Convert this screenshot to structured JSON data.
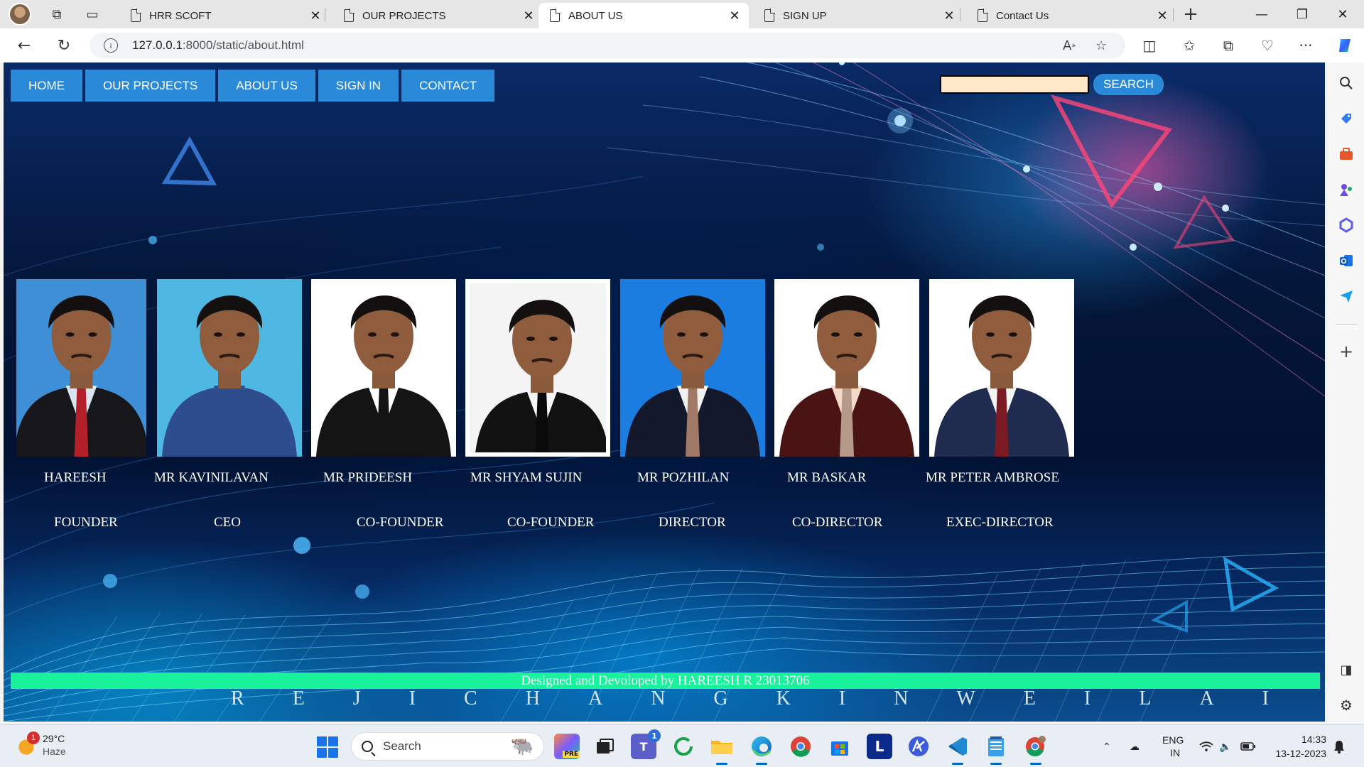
{
  "browser": {
    "tabs": [
      {
        "label": "HRR SCOFT",
        "active": false
      },
      {
        "label": "OUR PROJECTS",
        "active": false
      },
      {
        "label": "ABOUT US",
        "active": true
      },
      {
        "label": "SIGN UP",
        "active": false
      },
      {
        "label": "Contact Us",
        "active": false
      }
    ],
    "url_host": "127.0.0.1",
    "url_path": ":8000/static/about.html"
  },
  "page": {
    "nav": [
      "HOME",
      "OUR PROJECTS",
      "ABOUT US",
      "SIGN IN",
      "CONTACT"
    ],
    "search_button": "SEARCH",
    "members": [
      {
        "name": "HAREESH",
        "role": "FOUNDER",
        "bg": "#3f8fd6",
        "shirt": "#d9e6f2",
        "suit": "#17161b",
        "tie": "#b3202a"
      },
      {
        "name": "MR KAVINILAVAN",
        "role": "CEO",
        "bg": "#4fb8e2",
        "shirt": "#2d4d8c",
        "suit": "#2d4d8c",
        "tie": ""
      },
      {
        "name": "MR PRIDEESH",
        "role": "CO-FOUNDER",
        "bg": "#ffffff",
        "shirt": "#ffffff",
        "suit": "#141414",
        "tie": "#141414"
      },
      {
        "name": "MR SHYAM SUJIN",
        "role": "CO-FOUNDER",
        "bg": "#f4f4f4",
        "shirt": "#f7f7f7",
        "suit": "#121212",
        "tie": "#0a0a0a"
      },
      {
        "name": "MR POZHILAN",
        "role": "DIRECTOR",
        "bg": "#1b7de0",
        "shirt": "#f1f1f1",
        "suit": "#13182b",
        "tie": "#a07a66"
      },
      {
        "name": "MR BASKAR",
        "role": "CO-DIRECTOR",
        "bg": "#ffffff",
        "shirt": "#f3d9c7",
        "suit": "#4a1414",
        "tie": "#b59a8a"
      },
      {
        "name": "MR PETER AMBROSE",
        "role": "EXEC-DIRECTOR",
        "bg": "#ffffff",
        "shirt": "#f4f4f4",
        "suit": "#1f2c4f",
        "tie": "#7a1a22"
      }
    ],
    "footer": "Designed and Devoloped by HAREESH R 23013706",
    "ghost_letters": [
      "R",
      "E",
      "J",
      "I",
      "C",
      "H",
      "A",
      "N",
      "G",
      "K",
      "I",
      "N",
      "W",
      "E",
      "I",
      "L",
      "A",
      "I"
    ]
  },
  "taskbar": {
    "weather_temp": "29°C",
    "weather_cond": "Haze",
    "weather_badge": "1",
    "search_label": "Search",
    "lang_top": "ENG",
    "lang_bottom": "IN",
    "time": "14:33",
    "date": "13-12-2023",
    "teams_badge": "1"
  }
}
